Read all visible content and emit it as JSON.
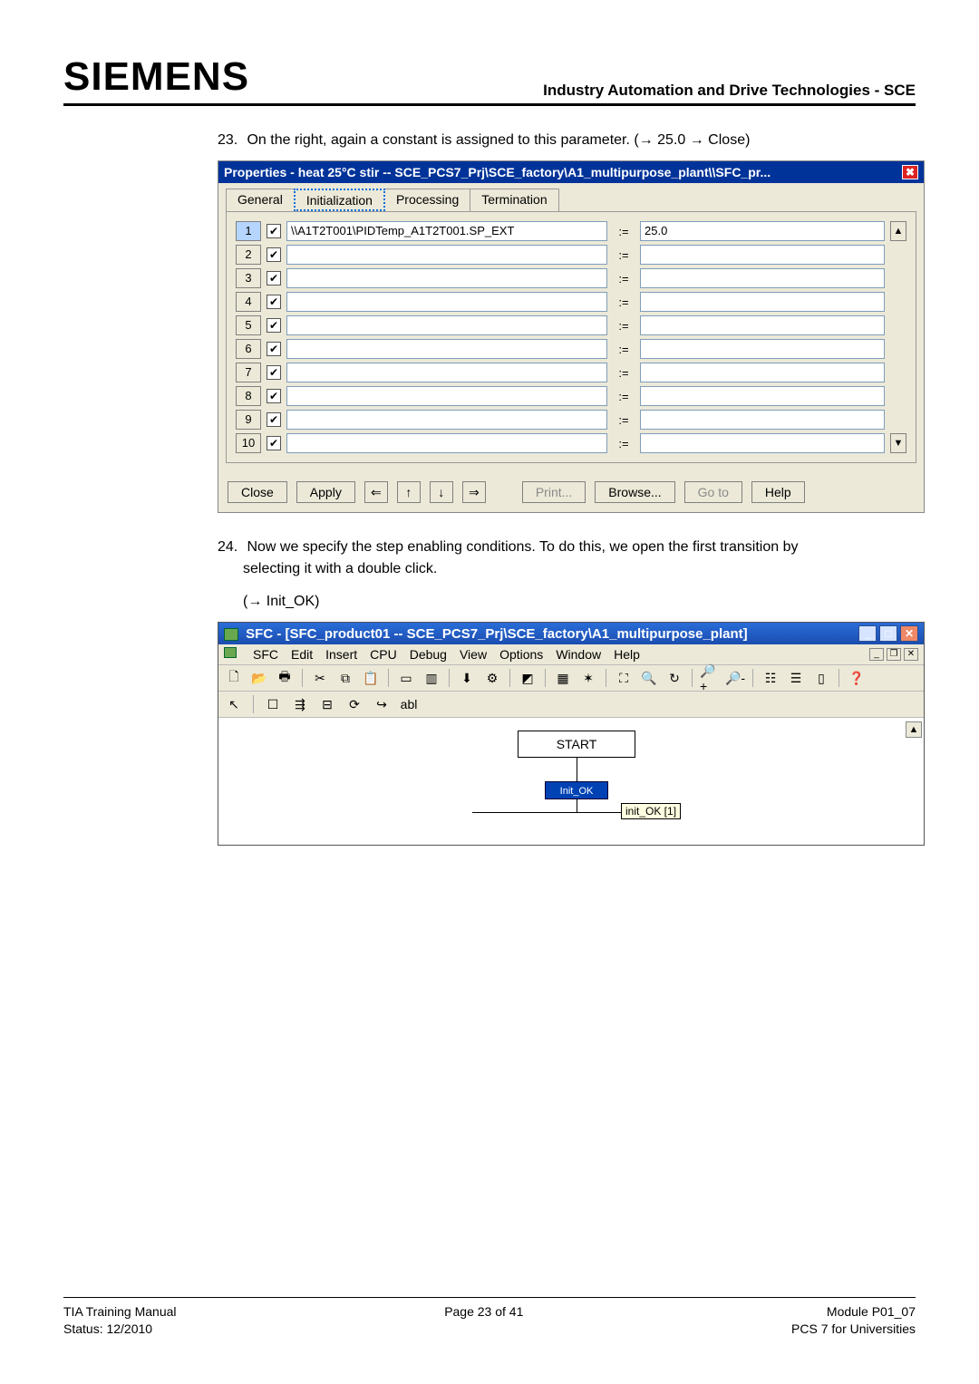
{
  "header": {
    "brand": "SIEMENS",
    "right": "Industry Automation and Drive Technologies - SCE"
  },
  "step23": {
    "num": "23.",
    "text_a": "On the right, again a constant is assigned to this parameter. (",
    "arrow1": "→",
    "val": " 25.0 ",
    "arrow2": "→",
    "text_b": " Close)"
  },
  "dlg1": {
    "title": "Properties -  heat 25°C stir -- SCE_PCS7_Prj\\SCE_factory\\A1_multipurpose_plant\\\\SFC_pr...",
    "tabs": {
      "general": "General",
      "initialization": "Initialization",
      "processing": "Processing",
      "termination": "Termination"
    },
    "rows": [
      {
        "idx": "1",
        "left": "\\\\A1T2T001\\PIDTemp_A1T2T001.SP_EXT",
        "op": ":=",
        "right": "25.0"
      },
      {
        "idx": "2",
        "left": "",
        "op": ":=",
        "right": ""
      },
      {
        "idx": "3",
        "left": "",
        "op": ":=",
        "right": ""
      },
      {
        "idx": "4",
        "left": "",
        "op": ":=",
        "right": ""
      },
      {
        "idx": "5",
        "left": "",
        "op": ":=",
        "right": ""
      },
      {
        "idx": "6",
        "left": "",
        "op": ":=",
        "right": ""
      },
      {
        "idx": "7",
        "left": "",
        "op": ":=",
        "right": ""
      },
      {
        "idx": "8",
        "left": "",
        "op": ":=",
        "right": ""
      },
      {
        "idx": "9",
        "left": "",
        "op": ":=",
        "right": ""
      },
      {
        "idx": "10",
        "left": "",
        "op": ":=",
        "right": ""
      }
    ],
    "buttons": {
      "close": "Close",
      "apply": "Apply",
      "print": "Print...",
      "browse": "Browse...",
      "goto": "Go to",
      "help": "Help"
    }
  },
  "step24": {
    "num": "24.",
    "line1": "Now we specify the step enabling conditions.  To do this, we open the first transition by",
    "line2": "selecting it with a double click.",
    "arrow": "→",
    "hint": " Init_OK)"
  },
  "sfc": {
    "title": "SFC - [SFC_product01 -- SCE_PCS7_Prj\\SCE_factory\\A1_multipurpose_plant]",
    "menus": [
      "SFC",
      "Edit",
      "Insert",
      "CPU",
      "Debug",
      "View",
      "Options",
      "Window",
      "Help"
    ],
    "start": "START",
    "trans": "Init_OK",
    "tooltip": "init_OK [1]"
  },
  "footer": {
    "l1": "TIA Training Manual",
    "l2": "Status: 12/2010",
    "c1": "Page 23 of 41",
    "r1": "Module P01_07",
    "r2": "PCS 7 for Universities"
  }
}
